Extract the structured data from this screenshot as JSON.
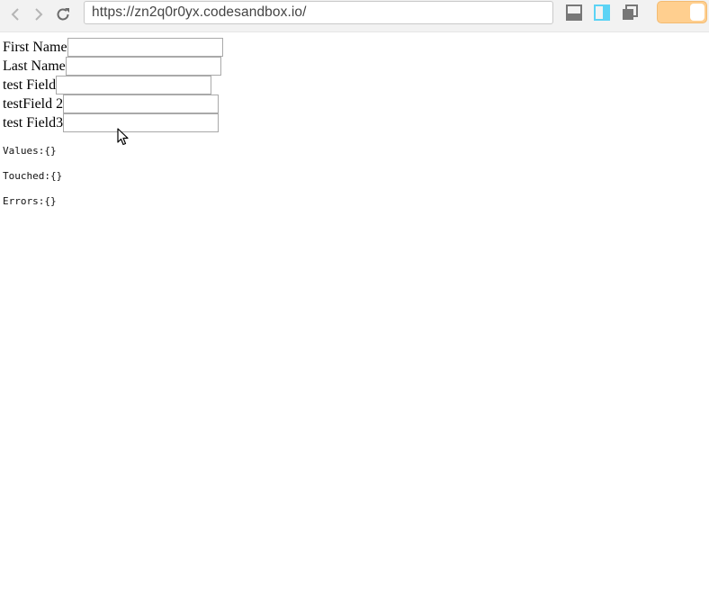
{
  "browser": {
    "url": "https://zn2q0r0yx.codesandbox.io/",
    "toolbar_icons": [
      "chevron-left-icon",
      "chevron-right-icon",
      "reload-icon",
      "layout-bottom-icon",
      "layout-split-icon",
      "layout-stack-icon"
    ],
    "toggle": {
      "state": "on",
      "color": "#ffcf8f"
    }
  },
  "form": {
    "fields": [
      {
        "label": "First Name",
        "value": ""
      },
      {
        "label": "Last Name",
        "value": ""
      },
      {
        "label": "test Field",
        "value": ""
      },
      {
        "label": "testField 2",
        "value": ""
      },
      {
        "label": "test Field3",
        "value": ""
      }
    ]
  },
  "debug": {
    "values": "Values:{}",
    "touched": "Touched:{}",
    "errors": "Errors:{}"
  },
  "colors": {
    "layout_active": "#5bd3f5",
    "icon_gray": "#777777"
  }
}
